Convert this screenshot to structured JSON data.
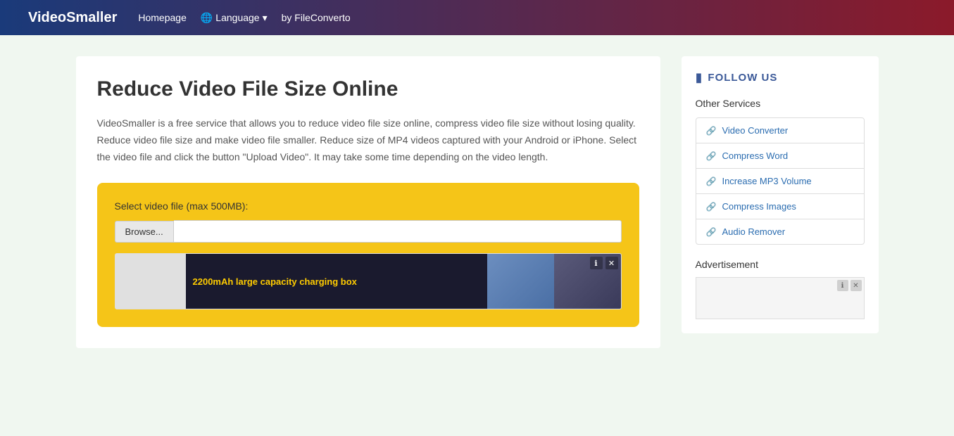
{
  "header": {
    "brand": "VideoSmaller",
    "nav": {
      "homepage": "Homepage",
      "language": "Language",
      "language_icon": "🌐",
      "by": "by FileConverto"
    }
  },
  "main": {
    "title": "Reduce Video File Size Online",
    "description": "VideoSmaller is a free service that allows you to reduce video file size online, compress video file size without losing quality. Reduce video file size and make video file smaller. Reduce size of MP4 videos captured with your Android or iPhone. Select the video file and click the button \"Upload Video\". It may take some time depending on the video length.",
    "upload_box": {
      "label": "Select video file (max 500MB):",
      "browse_label": "Browse...",
      "file_placeholder": ""
    },
    "ad": {
      "text": "2200mAh large capacity charging box"
    }
  },
  "sidebar": {
    "follow_us": "FOLLOW US",
    "other_services_title": "Other Services",
    "services": [
      {
        "label": "Video Converter",
        "icon": "↗"
      },
      {
        "label": "Compress Word",
        "icon": "↗"
      },
      {
        "label": "Increase MP3 Volume",
        "icon": "↗"
      },
      {
        "label": "Compress Images",
        "icon": "↗"
      },
      {
        "label": "Audio Remover",
        "icon": "↗"
      }
    ],
    "advertisement_title": "Advertisement"
  }
}
